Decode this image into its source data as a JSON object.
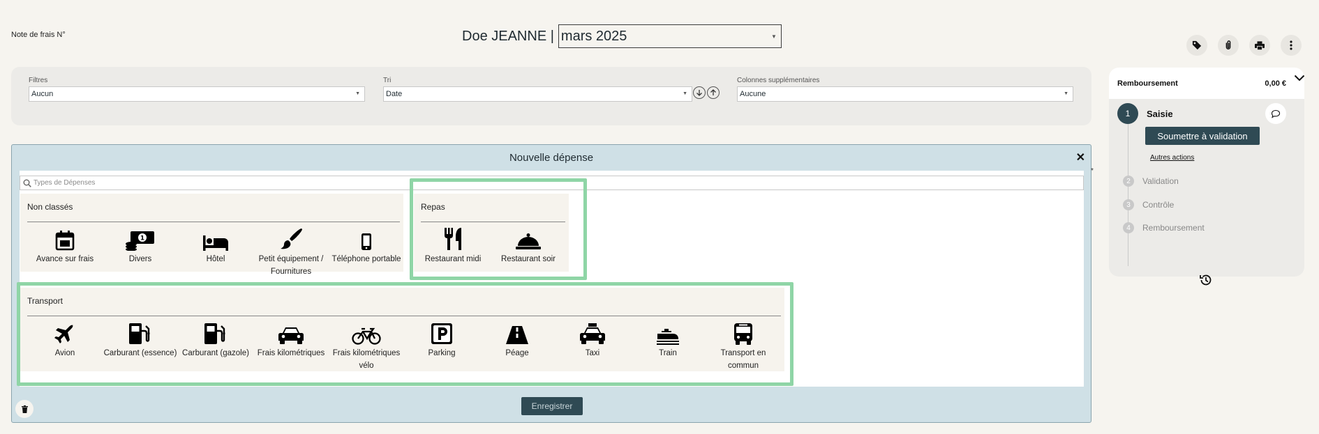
{
  "header": {
    "note_title": "Note de frais N°",
    "employee_name": "Doe JEANNE |",
    "month_value": "mars 2025"
  },
  "top_actions": [
    {
      "name": "tag-icon"
    },
    {
      "name": "attachment-icon"
    },
    {
      "name": "print-icon"
    },
    {
      "name": "more-icon"
    }
  ],
  "filters": {
    "filters_label": "Filtres",
    "filters_value": "Aucun",
    "sort_label": "Tri",
    "sort_value": "Date",
    "columns_label": "Colonnes supplémentaires",
    "columns_value": "Aucune"
  },
  "expense": {
    "title": "Nouvelle dépense",
    "search_placeholder": "Types de Dépenses",
    "save_label": "Enregistrer",
    "categories": {
      "uncategorized": {
        "title": "Non classés",
        "items": [
          "Avance sur frais",
          "Divers",
          "Hôtel",
          "Petit équipement / Fournitures",
          "Téléphone portable"
        ]
      },
      "meals": {
        "title": "Repas",
        "items": [
          "Restaurant midi",
          "Restaurant soir"
        ]
      },
      "transport": {
        "title": "Transport",
        "items": [
          "Avion",
          "Carburant (essence)",
          "Carburant (gazole)",
          "Frais kilométriques",
          "Frais kilométriques vélo",
          "Parking",
          "Péage",
          "Taxi",
          "Train",
          "Transport en commun"
        ]
      }
    },
    "highlight_color": "#8fd5a6"
  },
  "workflow": {
    "reimbursement_label": "Remboursement",
    "reimbursement_amount": "0,00 €",
    "submit_label": "Soumettre à validation",
    "other_actions": "Autres actions",
    "steps": [
      {
        "num": "1",
        "label": "Saisie"
      },
      {
        "num": "2",
        "label": "Validation"
      },
      {
        "num": "3",
        "label": "Contrôle"
      },
      {
        "num": "4",
        "label": "Remboursement"
      }
    ]
  },
  "colors": {
    "accent": "#2f4a54",
    "panel_bg": "#cfe0e6",
    "page_bg": "#f6f4ef"
  }
}
